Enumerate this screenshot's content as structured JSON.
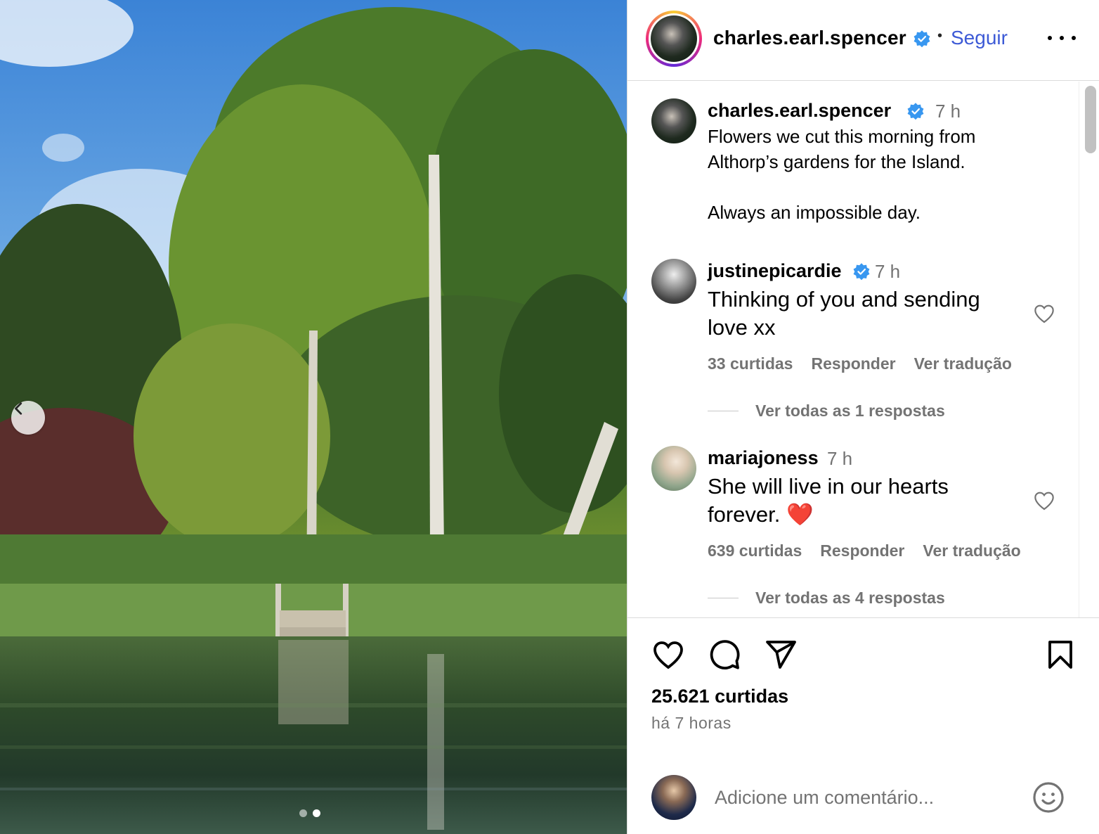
{
  "post": {
    "author": "charles.earl.spencer",
    "follow_label": "Seguir",
    "caption_time": "7 h",
    "caption_line1": "Flowers we cut this morning from",
    "caption_line2": "Althorp’s gardens for the Island.",
    "caption_line3": "Always an impossible day.",
    "likes": "25.621 curtidas",
    "time_ago": "há 7 horas",
    "carousel": {
      "count": 2,
      "active_index": 1
    }
  },
  "comments": [
    {
      "user": "justinepicardie",
      "verified": true,
      "time": "7 h",
      "line1": "Thinking of you and sending",
      "line2": "love xx",
      "likes": "33 curtidas",
      "reply_label": "Responder",
      "translate_label": "Ver tradução",
      "view_replies": "Ver todas as 1 respostas"
    },
    {
      "user": "mariajoness",
      "verified": false,
      "time": "7 h",
      "line1": "She will live in our hearts",
      "line2": "forever. ❤️",
      "likes": "639 curtidas",
      "reply_label": "Responder",
      "translate_label": "Ver tradução",
      "view_replies": "Ver todas as 4 respostas"
    }
  ],
  "compose": {
    "placeholder": "Adicione um comentário..."
  },
  "icons": {
    "header": [
      "verified-icon",
      "more-options-icon"
    ],
    "actions": [
      "heart-icon",
      "comment-icon",
      "share-icon",
      "bookmark-icon"
    ],
    "compose": [
      "emoji-icon"
    ],
    "photo": [
      "chevron-left-icon"
    ]
  },
  "colors": {
    "accent": "#3d5ad6",
    "verified": "#3897f0",
    "muted": "#737373",
    "border": "#dbdbdb"
  }
}
